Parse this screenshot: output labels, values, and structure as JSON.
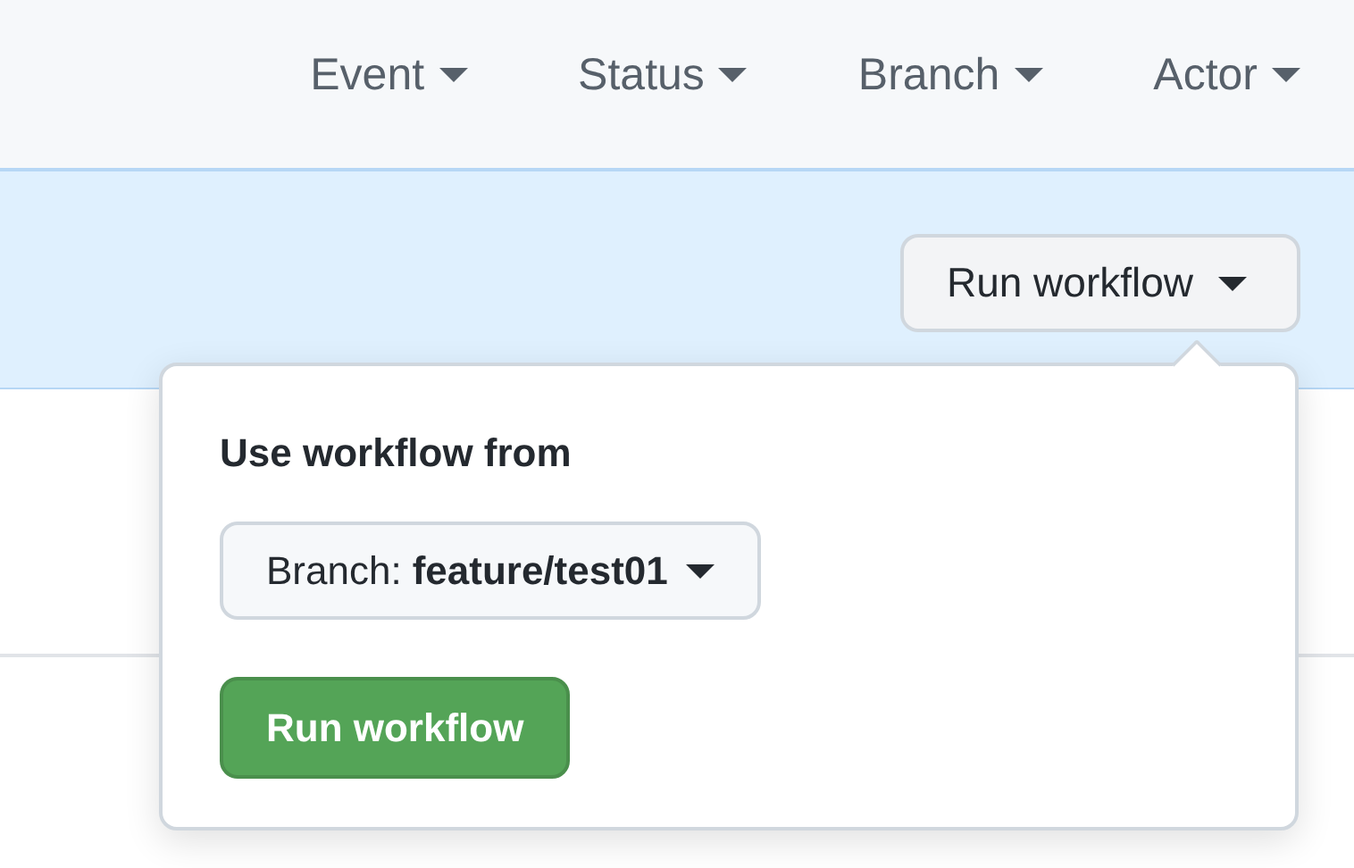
{
  "filters": [
    {
      "label": "Event"
    },
    {
      "label": "Status"
    },
    {
      "label": "Branch"
    },
    {
      "label": "Actor"
    }
  ],
  "run_button": {
    "label": "Run workflow"
  },
  "popup": {
    "heading": "Use workflow from",
    "branch_prefix": "Branch:",
    "branch": "feature/test01",
    "submit": "Run workflow"
  }
}
